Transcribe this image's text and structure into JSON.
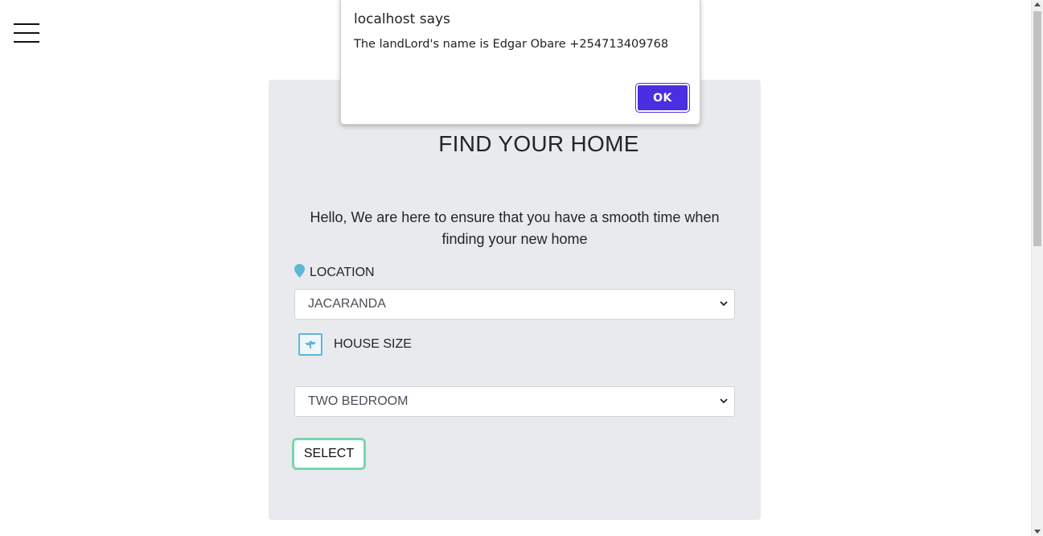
{
  "dialog": {
    "title": "localhost says",
    "message": "The landLord's name is Edgar Obare +254713409768",
    "ok_label": "OK"
  },
  "card": {
    "title": "FIND YOUR HOME",
    "intro": "Hello, We are here to ensure that you have a smooth time when finding your new home",
    "location": {
      "label": "LOCATION",
      "selected": "JACARANDA"
    },
    "house_size": {
      "label": "HOUSE SIZE",
      "selected": "TWO BEDROOM"
    },
    "submit_label": "SELECT"
  },
  "colors": {
    "card_bg": "#e9eaed",
    "accent_pin": "#5fb7d6",
    "select_button_border": "#76d7b1",
    "dialog_ok": "#4a2fe0"
  }
}
